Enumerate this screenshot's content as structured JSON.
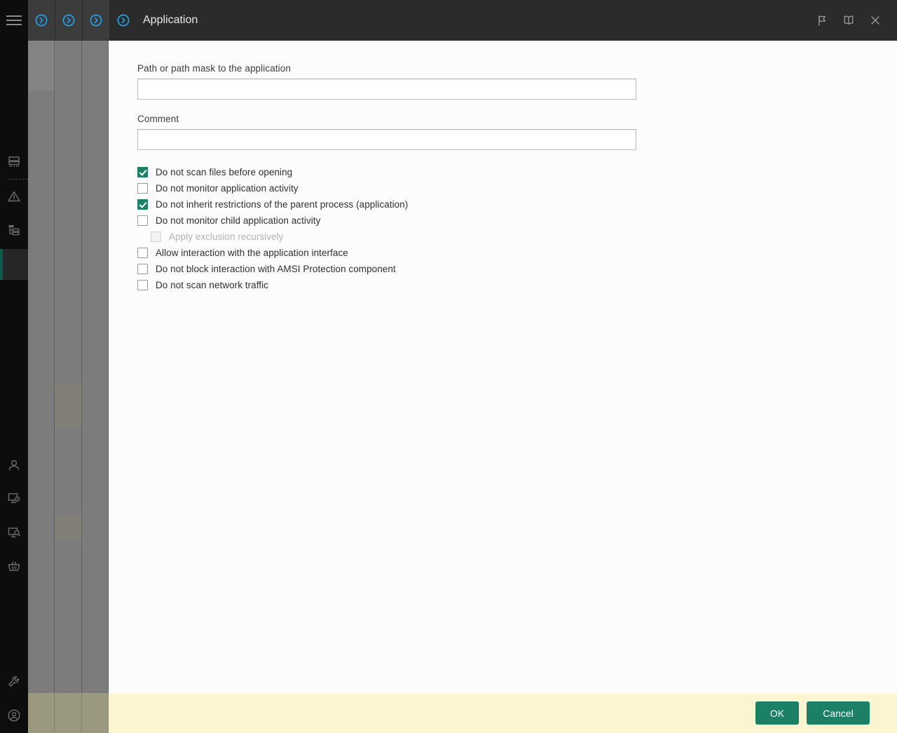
{
  "titlebar": {
    "menu_icon": "hamburger-menu-icon",
    "breadcrumbs": [
      {
        "icon": "chevron-right-circle-icon"
      },
      {
        "icon": "chevron-right-circle-icon"
      },
      {
        "icon": "chevron-right-circle-icon"
      },
      {
        "icon": "chevron-right-circle-icon"
      }
    ],
    "title": "Application",
    "actions": [
      {
        "name": "flag-icon",
        "label": "Flag"
      },
      {
        "name": "book-icon",
        "label": "Help"
      },
      {
        "name": "close-icon",
        "label": "Close"
      }
    ]
  },
  "sidebar": {
    "items": [
      {
        "icon": "server-icon"
      },
      {
        "icon": "warning-triangle-icon"
      },
      {
        "icon": "hierarchy-icon"
      },
      {
        "icon": "user-icon"
      },
      {
        "icon": "monitor-settings-icon"
      },
      {
        "icon": "monitor-search-icon"
      },
      {
        "icon": "basket-icon"
      },
      {
        "icon": "wrench-icon"
      },
      {
        "icon": "account-circle-icon"
      }
    ]
  },
  "form": {
    "path_label": "Path or path mask to the application",
    "path_value": "",
    "path_placeholder": "",
    "comment_label": "Comment",
    "comment_value": "",
    "comment_placeholder": ""
  },
  "checkboxes": [
    {
      "label": "Do not scan files before opening",
      "checked": true,
      "disabled": false,
      "indented": false,
      "name": "checkbox-do-not-scan-files-before-opening"
    },
    {
      "label": "Do not monitor application activity",
      "checked": false,
      "disabled": false,
      "indented": false,
      "name": "checkbox-do-not-monitor-application-activity"
    },
    {
      "label": "Do not inherit restrictions of the parent process (application)",
      "checked": true,
      "disabled": false,
      "indented": false,
      "name": "checkbox-do-not-inherit-restrictions"
    },
    {
      "label": "Do not monitor child application activity",
      "checked": false,
      "disabled": false,
      "indented": false,
      "name": "checkbox-do-not-monitor-child-application-activity"
    },
    {
      "label": "Apply exclusion recursively",
      "checked": false,
      "disabled": true,
      "indented": true,
      "name": "checkbox-apply-exclusion-recursively"
    },
    {
      "label": "Allow interaction with the application interface",
      "checked": false,
      "disabled": false,
      "indented": false,
      "name": "checkbox-allow-interaction-with-application-interface"
    },
    {
      "label": "Do not block interaction with AMSI Protection component",
      "checked": false,
      "disabled": false,
      "indented": false,
      "name": "checkbox-do-not-block-amsi-protection"
    },
    {
      "label": "Do not scan network traffic",
      "checked": false,
      "disabled": false,
      "indented": false,
      "name": "checkbox-do-not-scan-network-traffic"
    }
  ],
  "footer": {
    "ok_label": "OK",
    "cancel_label": "Cancel"
  },
  "colors": {
    "accent_green": "#1b8066",
    "accent_blue": "#22a0e8",
    "footer_bg": "#fcf5d2",
    "titlebar_bg": "#2b2b2b",
    "sidebar_bg": "#0d0d0d"
  }
}
